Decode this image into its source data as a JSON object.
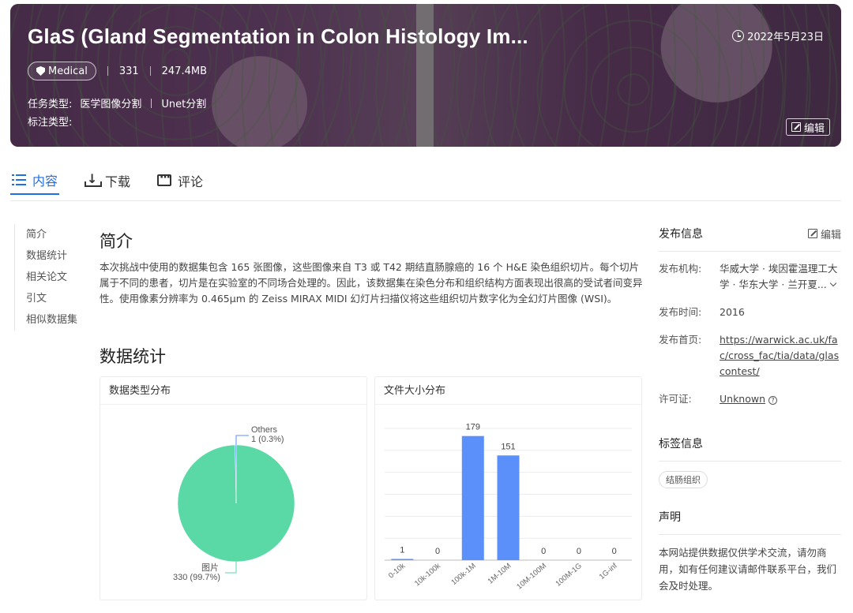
{
  "banner": {
    "title": "GlaS (Gland Segmentation in Colon Histology Im...",
    "date": "2022年5月23日",
    "tag": "Medical",
    "count": "331",
    "size": "247.4MB",
    "task_label": "任务类型:",
    "tasks": [
      "医学图像分割",
      "Unet分割"
    ],
    "annotation_label": "标注类型:",
    "edit_label": "编辑"
  },
  "tabs": [
    {
      "label": "内容",
      "active": true
    },
    {
      "label": "下载",
      "active": false
    },
    {
      "label": "评论",
      "active": false
    }
  ],
  "side_nav": [
    "简介",
    "数据统计",
    "相关论文",
    "引文",
    "相似数据集"
  ],
  "intro": {
    "title": "简介",
    "text": "本次挑战中使用的数据集包含 165 张图像，这些图像来自 T3 或 T42 期结直肠腺癌的 16 个 H&E 染色组织切片。每个切片属于不同的患者，切片是在实验室的不同场合处理的。因此，该数据集在染色分布和组织结构方面表现出很高的受试者间变异性。使用像素分辨率为 0.465μm 的 Zeiss MIRAX MIDI 幻灯片扫描仪将这些组织切片数字化为全幻灯片图像 (WSI)。"
  },
  "stats_title": "数据统计",
  "chart_data": [
    {
      "type": "pie",
      "title": "数据类型分布",
      "slices": [
        {
          "label": "图片",
          "value": 330,
          "display": "330 (99.7%)",
          "color": "#5ad8a6"
        },
        {
          "label": "Others",
          "value": 1,
          "display": "1 (0.3%)",
          "color": "#5b8ff9"
        }
      ]
    },
    {
      "type": "bar",
      "title": "文件大小分布",
      "categories": [
        "0-10k",
        "10k-100k",
        "100k-1M",
        "1M-10M",
        "10M-100M",
        "100M-1G",
        "1G-inf"
      ],
      "values": [
        1,
        0,
        179,
        151,
        0,
        0,
        0
      ],
      "ylim": [
        0,
        190
      ],
      "color": "#5b8ff9",
      "grid": true
    }
  ],
  "publish": {
    "title": "发布信息",
    "edit_label": "编辑",
    "org_label": "发布机构:",
    "org_value": "华威大学 · 埃因霍温理工大学 · 华东大学 · 兰开夏...",
    "time_label": "发布时间:",
    "time_value": "2016",
    "home_label": "发布首页:",
    "home_value": "https://warwick.ac.uk/fac/cross_fac/tia/data/glascontest/",
    "license_label": "许可证:",
    "license_value": "Unknown"
  },
  "tags": {
    "title": "标签信息",
    "items": [
      "结肠组织"
    ]
  },
  "notice": {
    "title": "声明",
    "text": "本网站提供数据仅供学术交流，请勿商用，如有任何建议请邮件联系平台，我们会及时处理。"
  }
}
